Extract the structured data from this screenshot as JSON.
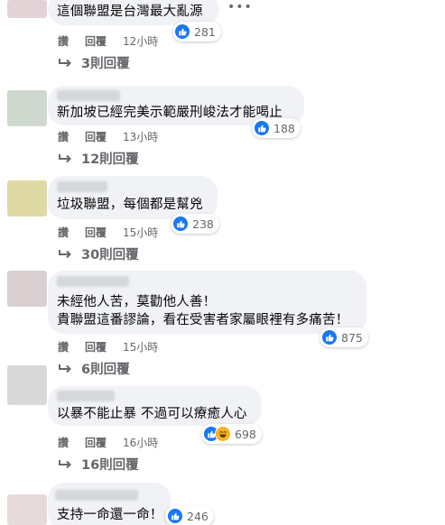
{
  "comments": [
    {
      "text_lines": [
        "這個聯盟是台灣最大亂源"
      ],
      "reaction_count": "281",
      "actions": {
        "like": "讚",
        "reply": "回覆",
        "time": "12小時"
      },
      "replies_label": "3則回覆",
      "avatar_color": "#e4d3d6"
    },
    {
      "text_lines": [
        "新加坡已經完美示範嚴刑峻法才能喝止"
      ],
      "reaction_count": "188",
      "actions": {
        "like": "讚",
        "reply": "回覆",
        "time": "13小時"
      },
      "replies_label": "12則回覆",
      "avatar_color": "#cfd8ce"
    },
    {
      "text_lines": [
        "垃圾聯盟，每個都是幫兇"
      ],
      "reaction_count": "238",
      "actions": {
        "like": "讚",
        "reply": "回覆",
        "time": "15小時"
      },
      "replies_label": "30則回覆",
      "avatar_color": "#dfd9a6"
    },
    {
      "text_lines": [
        "未經他人苦，莫勸他人善！",
        "貴聯盟這番謬論，看在受害者家屬眼裡有多痛苦！"
      ],
      "reaction_count": "875",
      "actions": {
        "like": "讚",
        "reply": "回覆",
        "time": "15小時"
      },
      "replies_label": "6則回覆",
      "avatar_color": "#d9cfd1"
    },
    {
      "text_lines": [
        "以暴不能止暴 不過可以療癒人心"
      ],
      "reaction_count": "698",
      "actions": {
        "like": "讚",
        "reply": "回覆",
        "time": "16小時"
      },
      "replies_label": "16則回覆",
      "avatar_color": "#d8d8d8"
    },
    {
      "text_lines": [
        "支持一命還一命！"
      ],
      "reaction_count": "246",
      "avatar_color": "#e6dadb"
    }
  ],
  "more_options_label": "•••",
  "colors": {
    "like_blue": "#1877f2",
    "bubble_bg": "#f0f2f5",
    "meta_gray": "#65676b"
  }
}
